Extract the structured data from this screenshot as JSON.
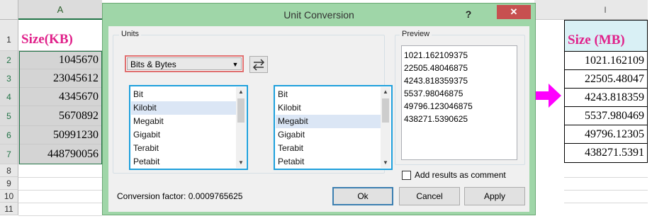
{
  "left_sheet": {
    "column_letter": "A",
    "row_numbers": [
      "1",
      "2",
      "3",
      "4",
      "5",
      "6",
      "7",
      "8",
      "9",
      "10",
      "11"
    ],
    "header": "Size(KB)",
    "values": [
      "1045670",
      "23045612",
      "4345670",
      "5670892",
      "50991230",
      "448790056"
    ]
  },
  "right_sheet": {
    "column_letter": "I",
    "header": "Size (MB)",
    "values": [
      "1021.162109",
      "22505.48047",
      "4243.818359",
      "5537.980469",
      "49796.12305",
      "438271.5391"
    ]
  },
  "dialog": {
    "title": "Unit Conversion",
    "help_glyph": "?",
    "close_glyph": "✕",
    "units_group_label": "Units",
    "category_selected": "Bits & Bytes",
    "from_list": [
      "Bit",
      "Kilobit",
      "Megabit",
      "Gigabit",
      "Terabit",
      "Petabit"
    ],
    "from_selected_index": 1,
    "to_list": [
      "Bit",
      "Kilobit",
      "Megabit",
      "Gigabit",
      "Terabit",
      "Petabit"
    ],
    "to_selected_index": 2,
    "preview_label": "Preview",
    "preview_lines": [
      "1021.162109375",
      "22505.48046875",
      "4243.818359375",
      "5537.98046875",
      "49796.123046875",
      "438271.5390625"
    ],
    "add_comment_label": "Add results as comment",
    "add_comment_checked": false,
    "conversion_factor": "Conversion factor: 0.0009765625",
    "buttons": {
      "ok": "Ok",
      "cancel": "Cancel",
      "apply": "Apply"
    }
  },
  "colors": {
    "dialog_frame": "#9fd6a8",
    "header_text": "#e0218a",
    "list_border": "#1ea0dc",
    "arrow": "#ff00ff",
    "right_header_fill": "#d9f0f5"
  }
}
